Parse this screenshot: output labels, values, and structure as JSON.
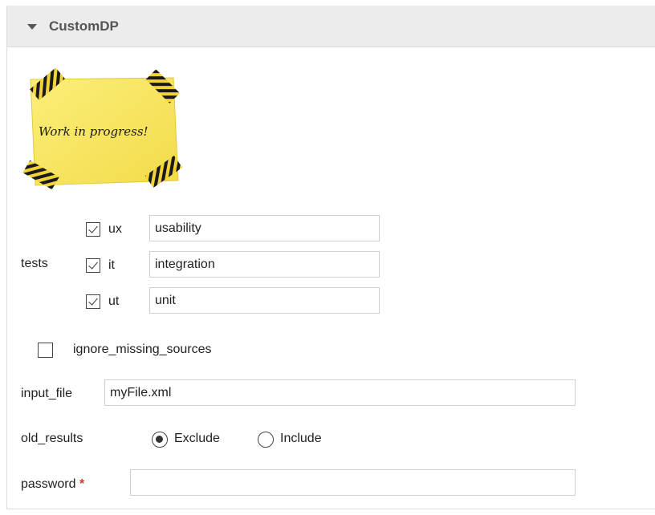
{
  "panel": {
    "title": "CustomDP"
  },
  "note": {
    "text": "Work in progress!"
  },
  "tests": {
    "label": "tests",
    "rows": [
      {
        "key": "ux",
        "checked": true,
        "value": "usability"
      },
      {
        "key": "it",
        "checked": true,
        "value": "integration"
      },
      {
        "key": "ut",
        "checked": true,
        "value": "unit"
      }
    ]
  },
  "ignore_missing_sources": {
    "label": "ignore_missing_sources",
    "checked": false
  },
  "input_file": {
    "label": "input_file",
    "value": "myFile.xml"
  },
  "old_results": {
    "label": "old_results",
    "options": [
      {
        "label": "Exclude",
        "selected": true
      },
      {
        "label": "Include",
        "selected": false
      }
    ]
  },
  "password": {
    "label": "password",
    "required_mark": "*",
    "value": ""
  }
}
